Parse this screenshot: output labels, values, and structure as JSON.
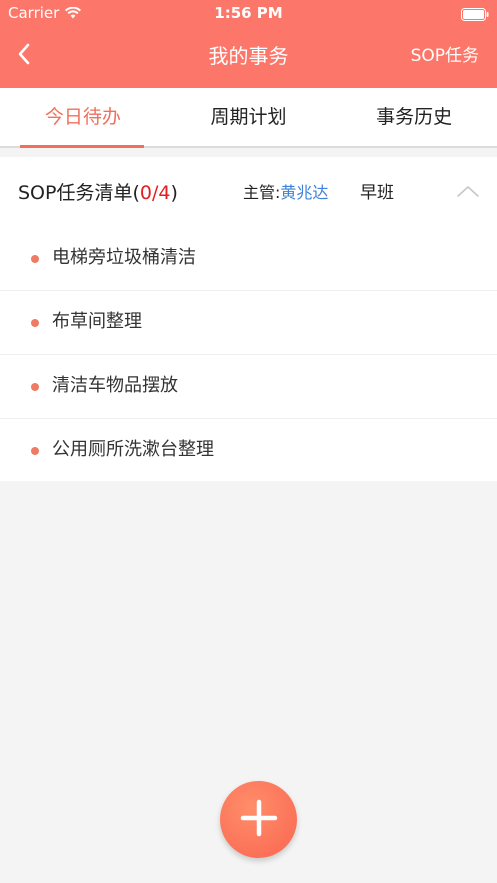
{
  "status_bar": {
    "carrier": "Carrier",
    "time": "1:56 PM",
    "icons": [
      "wifi-icon",
      "battery-icon"
    ]
  },
  "nav": {
    "back_icon": "chevron-left-icon",
    "title": "我的事务",
    "right_action": "SOP任务"
  },
  "tabs": [
    {
      "label": "今日待办",
      "active": true
    },
    {
      "label": "周期计划",
      "active": false
    },
    {
      "label": "事务历史",
      "active": false
    }
  ],
  "sop_card": {
    "title_prefix": "SOP任务清单(",
    "done_count": "0/4",
    "title_suffix": ")",
    "supervisor_label": "主管:",
    "supervisor_name": "黄兆达",
    "shift": "早班",
    "collapse_icon": "chevron-up-icon",
    "tasks": [
      {
        "label": "电梯旁垃圾桶清洁"
      },
      {
        "label": "布草间整理"
      },
      {
        "label": "清洁车物品摆放"
      },
      {
        "label": "公用厕所洗漱台整理"
      }
    ]
  },
  "fab": {
    "icon": "plus-icon"
  },
  "colors": {
    "header_bg": "#fc776a",
    "accent": "#f0705e",
    "count_red": "#e02020",
    "link_blue": "#3d82d8",
    "background": "#f4f4f4"
  }
}
